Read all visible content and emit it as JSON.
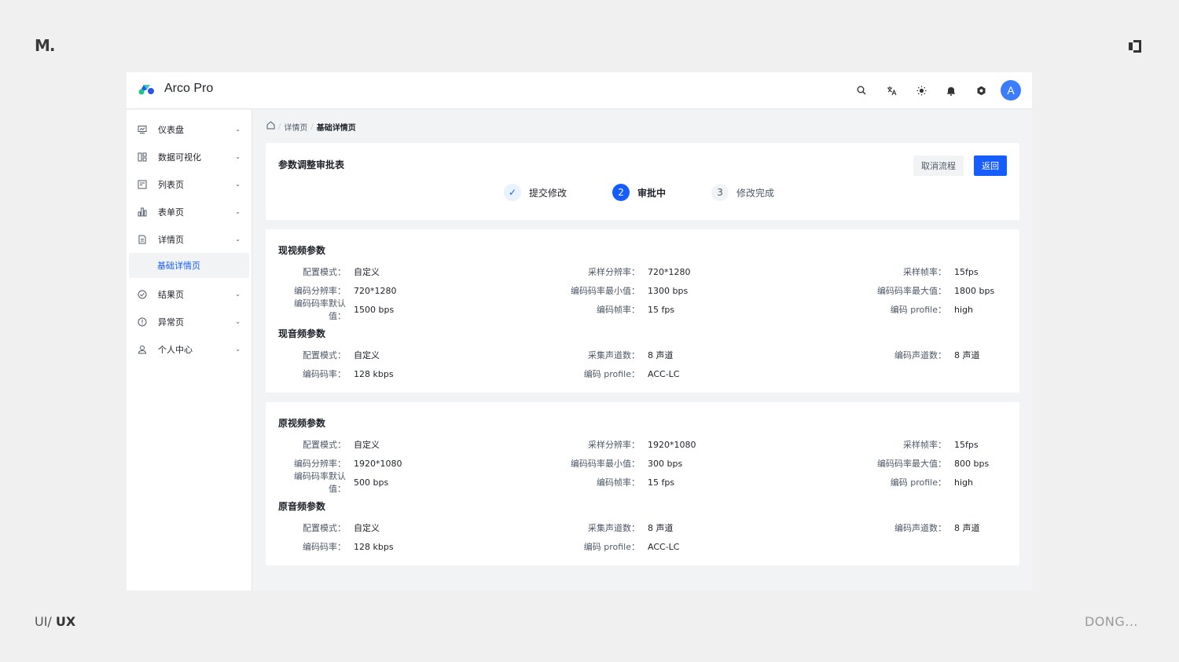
{
  "page": {
    "corner_logo": "M.",
    "footer_left_prefix": "UI/",
    "footer_left_bold": "UX",
    "footer_right": "DONG..."
  },
  "navbar": {
    "brand": "Arco Pro",
    "avatar_letter": "A",
    "icons": [
      "search-icon",
      "translate-icon",
      "theme-icon",
      "bell-icon",
      "settings-icon"
    ]
  },
  "sidebar": {
    "items": [
      {
        "label": "仪表盘",
        "icon": "dashboard-icon"
      },
      {
        "label": "数据可视化",
        "icon": "visualization-icon"
      },
      {
        "label": "列表页",
        "icon": "list-icon"
      },
      {
        "label": "表单页",
        "icon": "form-icon"
      },
      {
        "label": "详情页",
        "icon": "detail-icon"
      },
      {
        "label": "结果页",
        "icon": "result-icon"
      },
      {
        "label": "异常页",
        "icon": "exception-icon"
      },
      {
        "label": "个人中心",
        "icon": "user-icon"
      }
    ],
    "active_sub": "基础详情页"
  },
  "breadcrumb": {
    "items": [
      "详情页",
      "基础详情页"
    ],
    "sep": "/"
  },
  "header_card": {
    "title": "参数调整审批表",
    "cancel_label": "取消流程",
    "back_label": "返回",
    "steps": [
      {
        "num": "✓",
        "label": "提交修改",
        "state": "done"
      },
      {
        "num": "2",
        "label": "审批中",
        "state": "active"
      },
      {
        "num": "3",
        "label": "修改完成",
        "state": "wait"
      }
    ]
  },
  "current": {
    "video_title": "现视频参数",
    "video_rows": [
      [
        [
          "配置模式：",
          "自定义"
        ],
        [
          "采样分辨率：",
          "720*1280"
        ],
        [
          "采样帧率：",
          "15fps"
        ]
      ],
      [
        [
          "编码分辨率：",
          "720*1280"
        ],
        [
          "编码码率最小值：",
          "1300 bps"
        ],
        [
          "编码码率最大值：",
          "1800 bps"
        ]
      ],
      [
        [
          "编码码率默认值：",
          "1500 bps"
        ],
        [
          "编码帧率：",
          "15 fps"
        ],
        [
          "编码 profile：",
          "high"
        ]
      ]
    ],
    "audio_title": "现音频参数",
    "audio_rows": [
      [
        [
          "配置模式：",
          "自定义"
        ],
        [
          "采集声道数：",
          "8 声道"
        ],
        [
          "编码声道数：",
          "8 声道"
        ]
      ],
      [
        [
          "编码码率：",
          "128 kbps"
        ],
        [
          "编码 profile：",
          "ACC-LC"
        ]
      ]
    ]
  },
  "original": {
    "video_title": "原视频参数",
    "video_rows": [
      [
        [
          "配置模式：",
          "自定义"
        ],
        [
          "采样分辨率：",
          "1920*1080"
        ],
        [
          "采样帧率：",
          "15fps"
        ]
      ],
      [
        [
          "编码分辨率：",
          "1920*1080"
        ],
        [
          "编码码率最小值：",
          "300 bps"
        ],
        [
          "编码码率最大值：",
          "800 bps"
        ]
      ],
      [
        [
          "编码码率默认值：",
          "500 bps"
        ],
        [
          "编码帧率：",
          "15 fps"
        ],
        [
          "编码 profile：",
          "high"
        ]
      ]
    ],
    "audio_title": "原音频参数",
    "audio_rows": [
      [
        [
          "配置模式：",
          "自定义"
        ],
        [
          "采集声道数：",
          "8 声道"
        ],
        [
          "编码声道数：",
          "8 声道"
        ]
      ],
      [
        [
          "编码码率：",
          "128 kbps"
        ],
        [
          "编码 profile：",
          "ACC-LC"
        ]
      ]
    ]
  },
  "colors": {
    "primary": "#165dff",
    "avatar": "#3c7cff",
    "background": "#f2f3f5"
  }
}
